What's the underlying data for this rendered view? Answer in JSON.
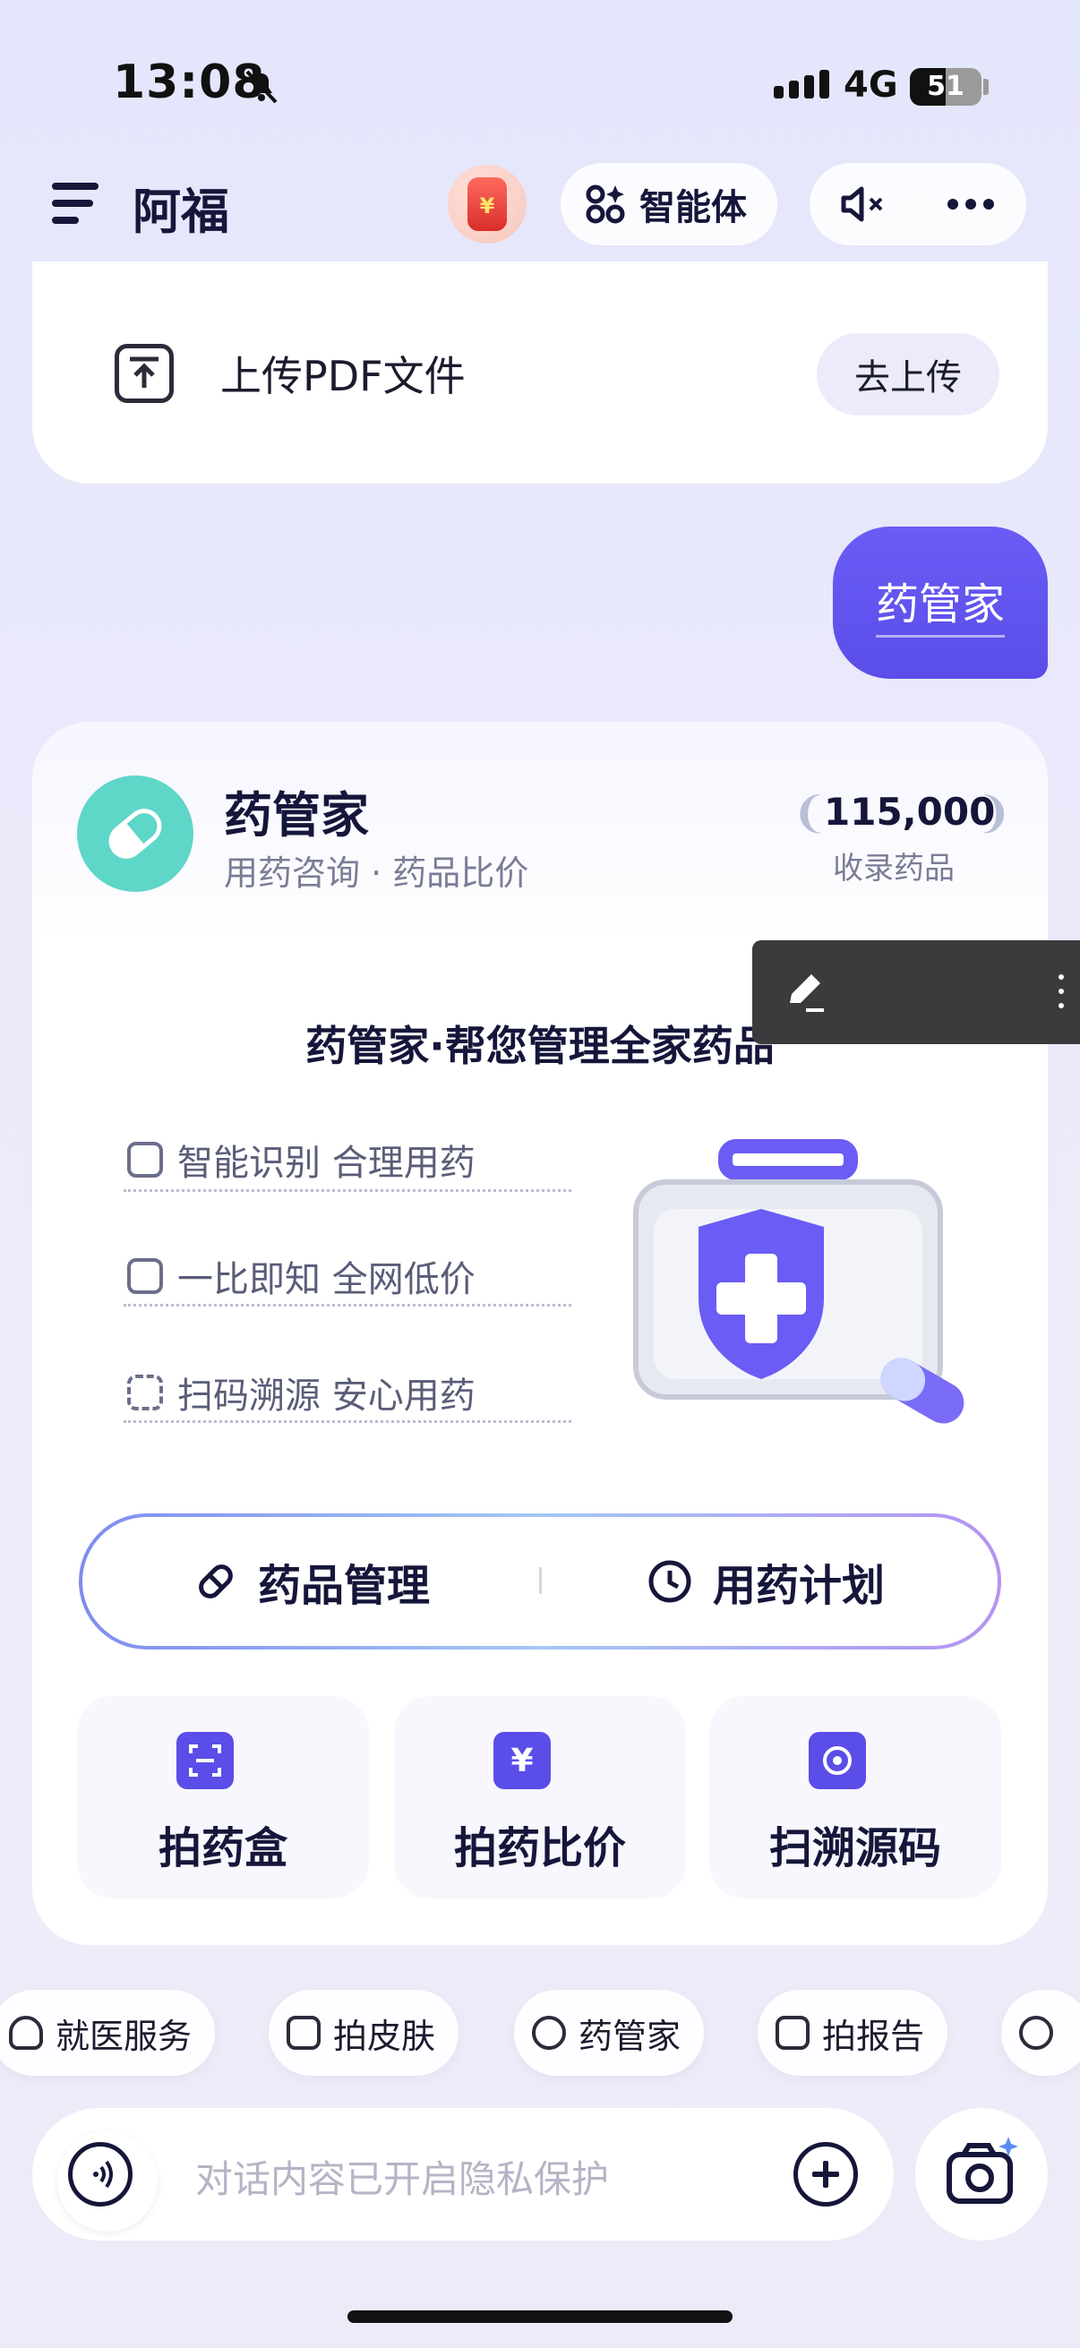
{
  "status_bar": {
    "time": "13:08",
    "network": "4G",
    "battery": "51"
  },
  "header": {
    "title": "阿福",
    "agent_label": "智能体"
  },
  "upload": {
    "text": "上传PDF文件",
    "button": "去上传"
  },
  "user_message": "药管家",
  "service": {
    "title": "药管家",
    "subtitle": "用药咨询 · 药品比价",
    "stat_value": "115,000",
    "stat_label": "收录药品",
    "headline": "药管家·帮您管理全家药品",
    "features": [
      "智能识别 合理用药",
      "一比即知 全网低价",
      "扫码溯源 安心用药"
    ],
    "segments": [
      "药品管理",
      "用药计划"
    ],
    "actions": [
      {
        "label": "拍药盒",
        "icon": "scan-icon"
      },
      {
        "label": "拍药比价",
        "icon": "yuan-icon"
      },
      {
        "label": "扫溯源码",
        "icon": "target-icon"
      }
    ]
  },
  "chips": [
    "就医服务",
    "拍皮肤",
    "药管家",
    "拍报告"
  ],
  "input": {
    "placeholder": "对话内容已开启隐私保护"
  },
  "colors": {
    "accent": "#5b4de8",
    "teal": "#5ed6c8",
    "text": "#15163a"
  }
}
